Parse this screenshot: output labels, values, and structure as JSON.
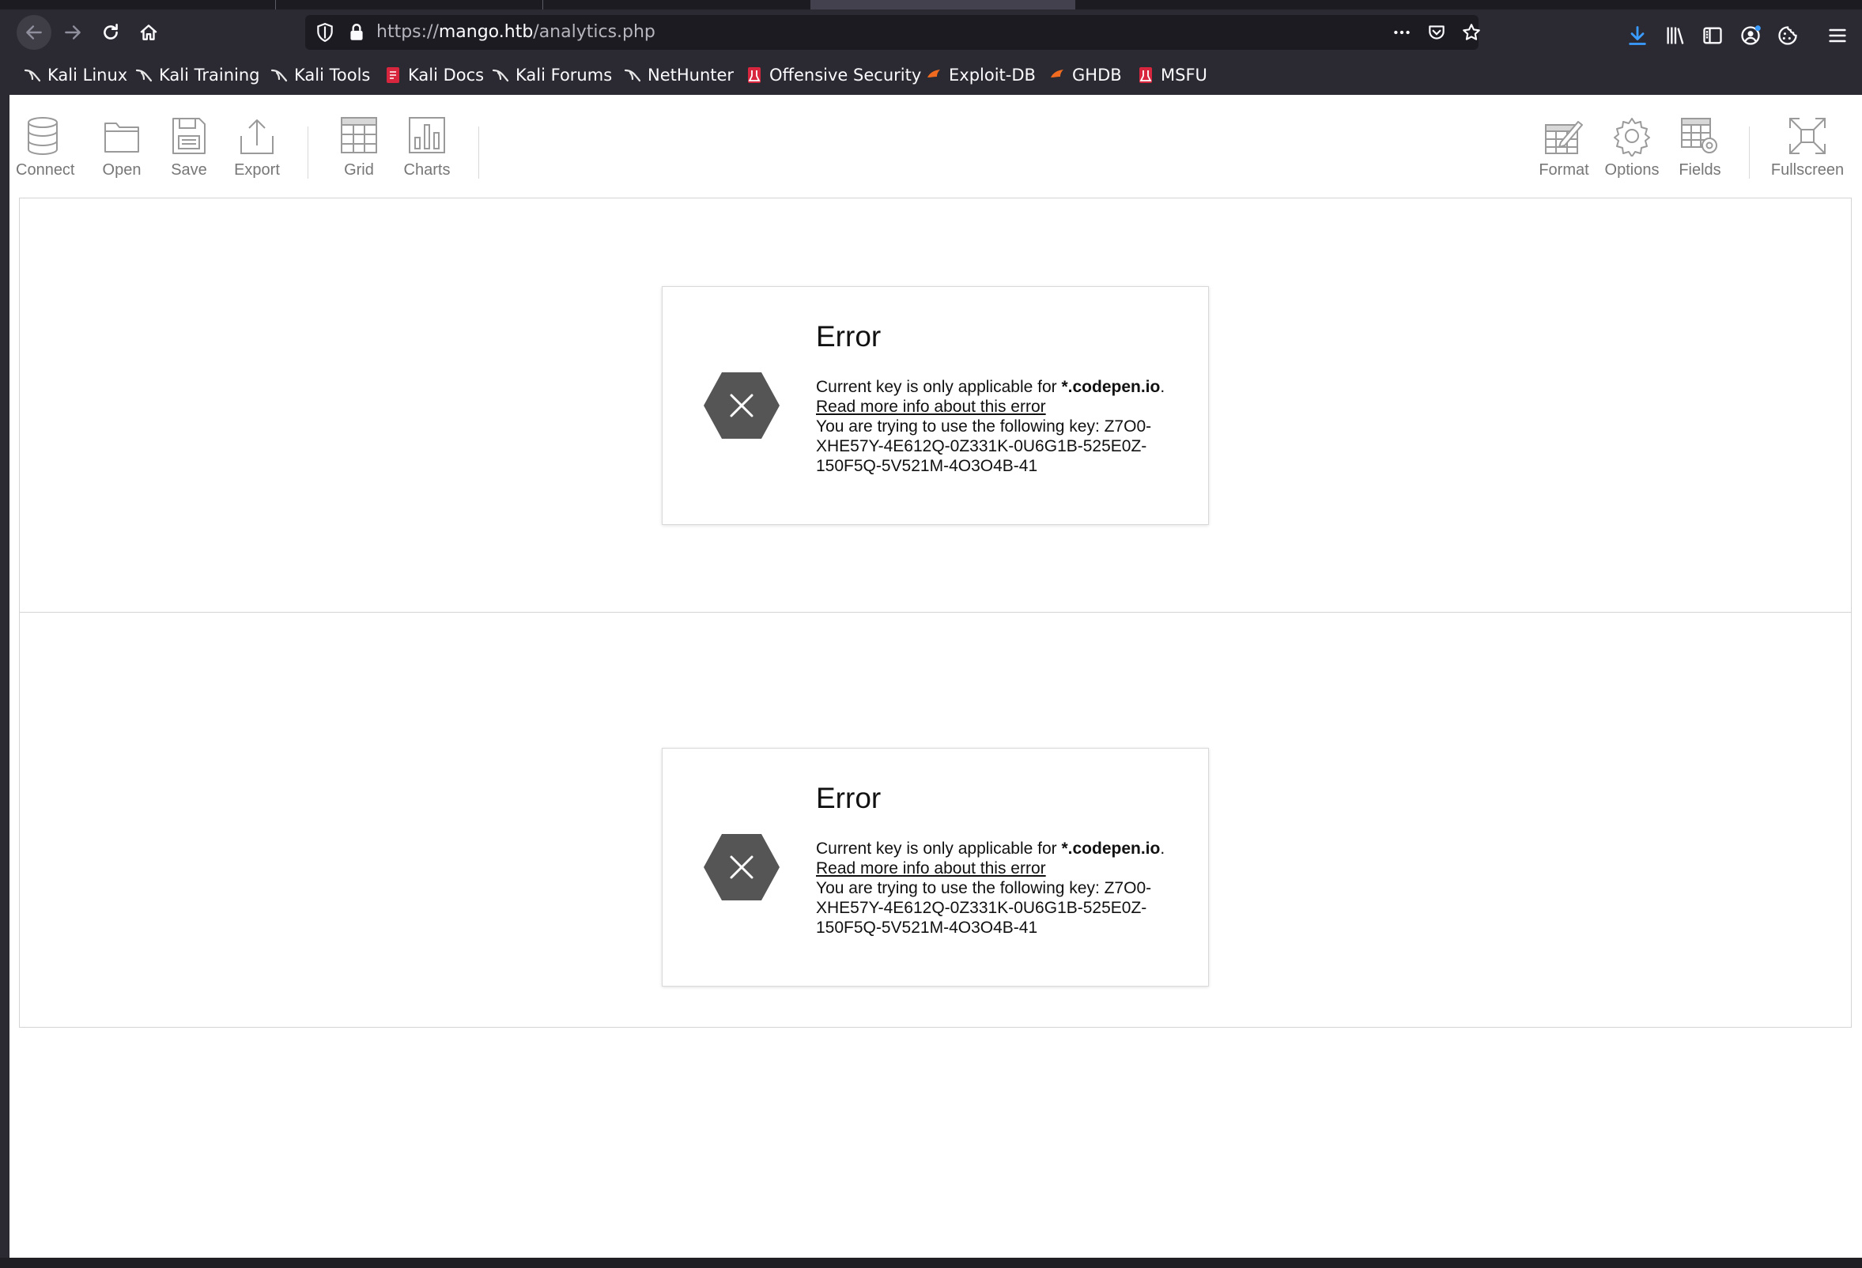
{
  "browser": {
    "url_scheme": "https://",
    "url_host": "mango.htb",
    "url_path": "/analytics.php",
    "bookmarks": [
      {
        "label": "Kali Linux",
        "icon": "kali-dragon-icon"
      },
      {
        "label": "Kali Training",
        "icon": "kali-dragon-icon"
      },
      {
        "label": "Kali Tools",
        "icon": "kali-dragon-icon"
      },
      {
        "label": "Kali Docs",
        "icon": "kali-docs-icon"
      },
      {
        "label": "Kali Forums",
        "icon": "kali-dragon-icon"
      },
      {
        "label": "NetHunter",
        "icon": "kali-dragon-icon"
      },
      {
        "label": "Offensive Security",
        "icon": "offsec-icon"
      },
      {
        "label": "Exploit-DB",
        "icon": "exploitdb-icon"
      },
      {
        "label": "GHDB",
        "icon": "exploitdb-icon"
      },
      {
        "label": "MSFU",
        "icon": "offsec-icon"
      }
    ]
  },
  "toolbar": {
    "left": [
      {
        "label": "Connect",
        "icon": "database-icon"
      },
      {
        "label": "Open",
        "icon": "folder-icon"
      },
      {
        "label": "Save",
        "icon": "floppy-icon"
      },
      {
        "label": "Export",
        "icon": "export-icon"
      },
      {
        "label": "Grid",
        "icon": "grid-icon"
      },
      {
        "label": "Charts",
        "icon": "bar-chart-icon"
      }
    ],
    "right": [
      {
        "label": "Format",
        "icon": "format-icon"
      },
      {
        "label": "Options",
        "icon": "gear-icon"
      },
      {
        "label": "Fields",
        "icon": "fields-icon"
      },
      {
        "label": "Fullscreen",
        "icon": "fullscreen-icon"
      }
    ]
  },
  "errors": [
    {
      "title": "Error",
      "line1_prefix": "Current key is only applicable for ",
      "line1_domain": "*.codepen.io",
      "line1_suffix": ".",
      "link": "Read more info about this error",
      "key_text": "You are trying to use the following key: Z7O0-XHE57Y-4E612Q-0Z331K-0U6G1B-525E0Z-150F5Q-5V521M-4O3O4B-41"
    },
    {
      "title": "Error",
      "line1_prefix": "Current key is only applicable for ",
      "line1_domain": "*.codepen.io",
      "line1_suffix": ".",
      "link": "Read more info about this error",
      "key_text": "You are trying to use the following key: Z7O0-XHE57Y-4E612Q-0Z331K-0U6G1B-525E0Z-150F5Q-5V521M-4O3O4B-41"
    }
  ],
  "colors": {
    "chrome_bg": "#2b2a33",
    "page_bg": "#ffffff",
    "icon_gray": "#9a9a9a",
    "error_hex": "#555555",
    "download_accent": "#3b9cff"
  }
}
